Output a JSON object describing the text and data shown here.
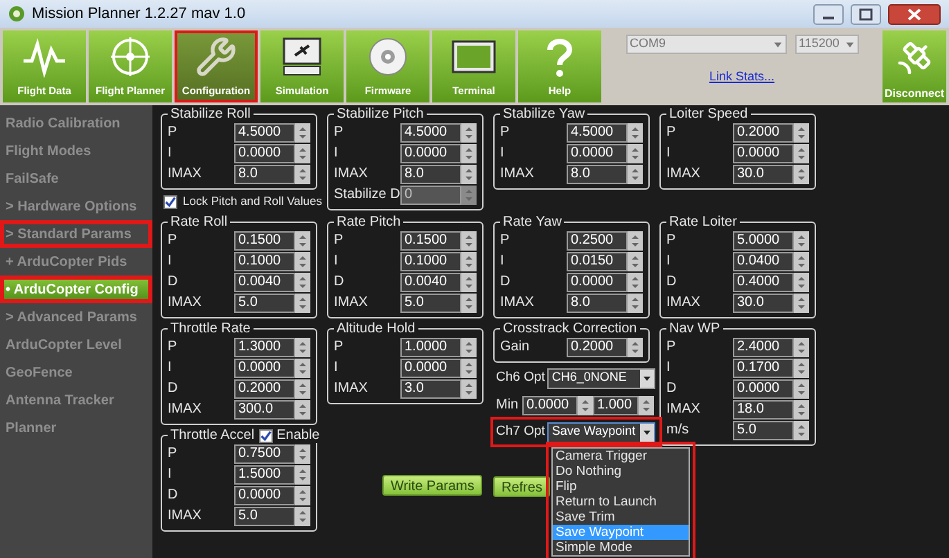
{
  "window": {
    "title": "Mission Planner 1.2.27 mav 1.0"
  },
  "toolbar": [
    {
      "label": "Flight Data",
      "kind": "pulse",
      "selected": false,
      "highlighted": false
    },
    {
      "label": "Flight Planner",
      "kind": "crosshair",
      "selected": false,
      "highlighted": false
    },
    {
      "label": "Configuration",
      "kind": "wrench",
      "selected": true,
      "highlighted": true
    },
    {
      "label": "Simulation",
      "kind": "sim",
      "selected": false,
      "highlighted": false
    },
    {
      "label": "Firmware",
      "kind": "disc",
      "selected": false,
      "highlighted": false
    },
    {
      "label": "Terminal",
      "kind": "screen",
      "selected": false,
      "highlighted": false
    },
    {
      "label": "Help",
      "kind": "help",
      "selected": false,
      "highlighted": false
    }
  ],
  "connection": {
    "port": "COM9",
    "baud": "115200",
    "link": "Link Stats...",
    "disconnect": "Disconnect"
  },
  "sidebar": [
    {
      "label": "Radio Calibration",
      "selected": false,
      "highlighted": false
    },
    {
      "label": "Flight Modes",
      "selected": false,
      "highlighted": false
    },
    {
      "label": "FailSafe",
      "selected": false,
      "highlighted": false
    },
    {
      "label": "> Hardware Options",
      "selected": false,
      "highlighted": false
    },
    {
      "label": "> Standard Params",
      "selected": false,
      "highlighted": true
    },
    {
      "label": "+ ArduCopter Pids",
      "selected": false,
      "highlighted": false
    },
    {
      "label": "• ArduCopter Config",
      "selected": true,
      "highlighted": true
    },
    {
      "label": "> Advanced Params",
      "selected": false,
      "highlighted": false
    },
    {
      "label": "ArduCopter Level",
      "selected": false,
      "highlighted": false
    },
    {
      "label": "GeoFence",
      "selected": false,
      "highlighted": false
    },
    {
      "label": "Antenna Tracker",
      "selected": false,
      "highlighted": false
    },
    {
      "label": "Planner",
      "selected": false,
      "highlighted": false
    }
  ],
  "rows": [
    [
      [
        {
          "kind": "group",
          "title": "Stabilize Roll",
          "fields": [
            {
              "label": "P",
              "value": "4.5000",
              "disabled": false
            },
            {
              "label": "I",
              "value": "0.0000",
              "disabled": false
            },
            {
              "label": "IMAX",
              "value": "8.0",
              "disabled": false
            }
          ]
        },
        {
          "kind": "checkbox",
          "label": "Lock Pitch and Roll Values",
          "checked": true
        }
      ],
      [
        {
          "kind": "group",
          "title": "Stabilize Pitch",
          "fields": [
            {
              "label": "P",
              "value": "4.5000",
              "disabled": false
            },
            {
              "label": "I",
              "value": "0.0000",
              "disabled": false
            },
            {
              "label": "IMAX",
              "value": "8.0",
              "disabled": false
            },
            {
              "label": "Stabilize D",
              "value": "0",
              "disabled": true
            }
          ]
        }
      ],
      [
        {
          "kind": "group",
          "title": "Stabilize Yaw",
          "fields": [
            {
              "label": "P",
              "value": "4.5000",
              "disabled": false
            },
            {
              "label": "I",
              "value": "0.0000",
              "disabled": false
            },
            {
              "label": "IMAX",
              "value": "8.0",
              "disabled": false
            }
          ]
        }
      ],
      [
        {
          "kind": "group",
          "title": "Loiter Speed",
          "fields": [
            {
              "label": "P",
              "value": "0.2000",
              "disabled": false
            },
            {
              "label": "I",
              "value": "0.0000",
              "disabled": false
            },
            {
              "label": "IMAX",
              "value": "30.0",
              "disabled": false
            }
          ]
        }
      ]
    ],
    [
      [
        {
          "kind": "group",
          "title": "Rate Roll",
          "fields": [
            {
              "label": "P",
              "value": "0.1500",
              "disabled": false
            },
            {
              "label": "I",
              "value": "0.1000",
              "disabled": false
            },
            {
              "label": "D",
              "value": "0.0040",
              "disabled": false
            },
            {
              "label": "IMAX",
              "value": "5.0",
              "disabled": false
            }
          ]
        }
      ],
      [
        {
          "kind": "group",
          "title": "Rate Pitch",
          "fields": [
            {
              "label": "P",
              "value": "0.1500",
              "disabled": false
            },
            {
              "label": "I",
              "value": "0.1000",
              "disabled": false
            },
            {
              "label": "D",
              "value": "0.0040",
              "disabled": false
            },
            {
              "label": "IMAX",
              "value": "5.0",
              "disabled": false
            }
          ]
        }
      ],
      [
        {
          "kind": "group",
          "title": "Rate Yaw",
          "fields": [
            {
              "label": "P",
              "value": "0.2500",
              "disabled": false
            },
            {
              "label": "I",
              "value": "0.0150",
              "disabled": false
            },
            {
              "label": "D",
              "value": "0.0000",
              "disabled": false
            },
            {
              "label": "IMAX",
              "value": "8.0",
              "disabled": false
            }
          ]
        }
      ],
      [
        {
          "kind": "group",
          "title": "Rate Loiter",
          "fields": [
            {
              "label": "P",
              "value": "5.0000",
              "disabled": false
            },
            {
              "label": "I",
              "value": "0.0400",
              "disabled": false
            },
            {
              "label": "D",
              "value": "0.4000",
              "disabled": false
            },
            {
              "label": "IMAX",
              "value": "30.0",
              "disabled": false
            }
          ]
        }
      ]
    ]
  ],
  "lower_columns": [
    [
      {
        "kind": "group",
        "title": "Throttle Rate",
        "fields": [
          {
            "label": "P",
            "value": "1.3000",
            "disabled": false
          },
          {
            "label": "I",
            "value": "0.0000",
            "disabled": false
          },
          {
            "label": "D",
            "value": "0.2000",
            "disabled": false
          },
          {
            "label": "IMAX",
            "value": "300.0",
            "disabled": false
          }
        ]
      },
      {
        "kind": "group",
        "title": "Throttle Accel",
        "enable": {
          "label": "Enable",
          "checked": true
        },
        "fields": [
          {
            "label": "P",
            "value": "0.7500",
            "disabled": false
          },
          {
            "label": "I",
            "value": "1.5000",
            "disabled": false
          },
          {
            "label": "D",
            "value": "0.0000",
            "disabled": false
          },
          {
            "label": "IMAX",
            "value": "5.0",
            "disabled": false
          }
        ]
      }
    ],
    [
      {
        "kind": "group",
        "title": "Altitude Hold",
        "fields": [
          {
            "label": "P",
            "value": "1.0000",
            "disabled": false
          },
          {
            "label": "I",
            "value": "0.0000",
            "disabled": false
          },
          {
            "label": "IMAX",
            "value": "3.0",
            "disabled": false
          }
        ]
      },
      {
        "kind": "button",
        "label": "Write Params"
      }
    ],
    [
      {
        "kind": "group",
        "title": "Crosstrack Correction",
        "fields": [
          {
            "label": "Gain",
            "value": "0.2000",
            "disabled": false
          }
        ]
      },
      {
        "kind": "select",
        "label": "Ch6 Opt",
        "value": "CH6_0NONE",
        "expanded": false
      },
      {
        "kind": "range",
        "label": "Min",
        "min": "0.0000",
        "max": "1.000"
      },
      {
        "kind": "select",
        "label": "Ch7 Opt",
        "value": "Save Waypoint",
        "expanded": true,
        "highlighted": true,
        "options": [
          {
            "label": "Camera Trigger",
            "selected": false
          },
          {
            "label": "Do Nothing",
            "selected": false
          },
          {
            "label": "Flip",
            "selected": false
          },
          {
            "label": "Return to Launch",
            "selected": false
          },
          {
            "label": "Save Trim",
            "selected": false
          },
          {
            "label": "Save Waypoint",
            "selected": true
          },
          {
            "label": "Simple Mode",
            "selected": false
          }
        ]
      },
      {
        "kind": "button",
        "label": "Refres"
      }
    ],
    [
      {
        "kind": "group",
        "title": "Nav WP",
        "fields": [
          {
            "label": "P",
            "value": "2.4000",
            "disabled": false
          },
          {
            "label": "I",
            "value": "0.1700",
            "disabled": false
          },
          {
            "label": "D",
            "value": "0.0000",
            "disabled": false
          },
          {
            "label": "IMAX",
            "value": "18.0",
            "disabled": false
          },
          {
            "label": "m/s",
            "value": "5.0",
            "disabled": false
          }
        ]
      }
    ]
  ]
}
